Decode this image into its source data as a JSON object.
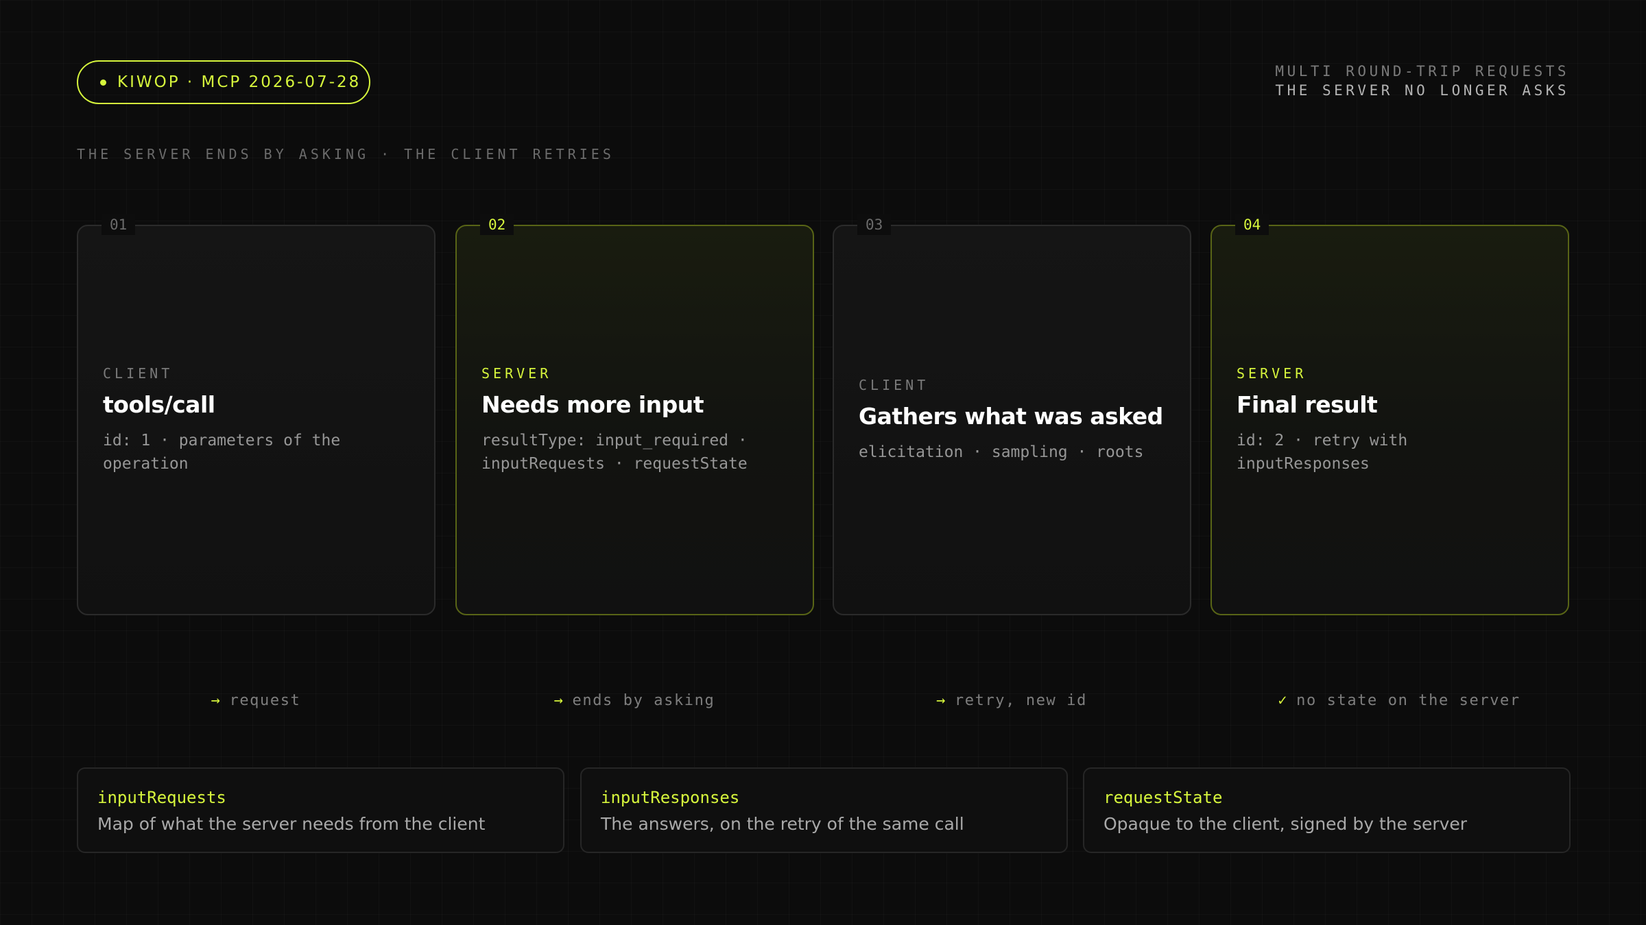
{
  "header": {
    "brand": "KIWOP · MCP 2026-07-28",
    "right_line1": "MULTI ROUND-TRIP REQUESTS",
    "right_line2": "THE SERVER NO LONGER ASKS",
    "subtitle": "THE SERVER ENDS BY ASKING · THE CLIENT RETRIES"
  },
  "steps": [
    {
      "num": "01",
      "role": "CLIENT",
      "title": "tools/call",
      "desc": "id: 1 · parameters of the operation"
    },
    {
      "num": "02",
      "role": "SERVER",
      "title": "Needs more input",
      "desc": "resultType: input_required · inputRequests · requestState"
    },
    {
      "num": "03",
      "role": "CLIENT",
      "title": "Gathers what was asked",
      "desc": "elicitation · sampling · roots"
    },
    {
      "num": "04",
      "role": "SERVER",
      "title": "Final result",
      "desc": "id: 2 · retry with inputResponses"
    }
  ],
  "flow": [
    {
      "glyph": "→",
      "text": "request"
    },
    {
      "glyph": "→",
      "text": "ends by asking"
    },
    {
      "glyph": "→",
      "text": "retry, new id"
    },
    {
      "glyph": "✓",
      "text": "no state on the server"
    }
  ],
  "glossary": [
    {
      "term": "inputRequests",
      "def": "Map of what the server needs from the client"
    },
    {
      "term": "inputResponses",
      "def": "The answers, on the retry of the same call"
    },
    {
      "term": "requestState",
      "def": "Opaque to the client, signed by the server"
    }
  ],
  "colors": {
    "accent": "#d6f53c",
    "background": "#0c0c0c"
  }
}
